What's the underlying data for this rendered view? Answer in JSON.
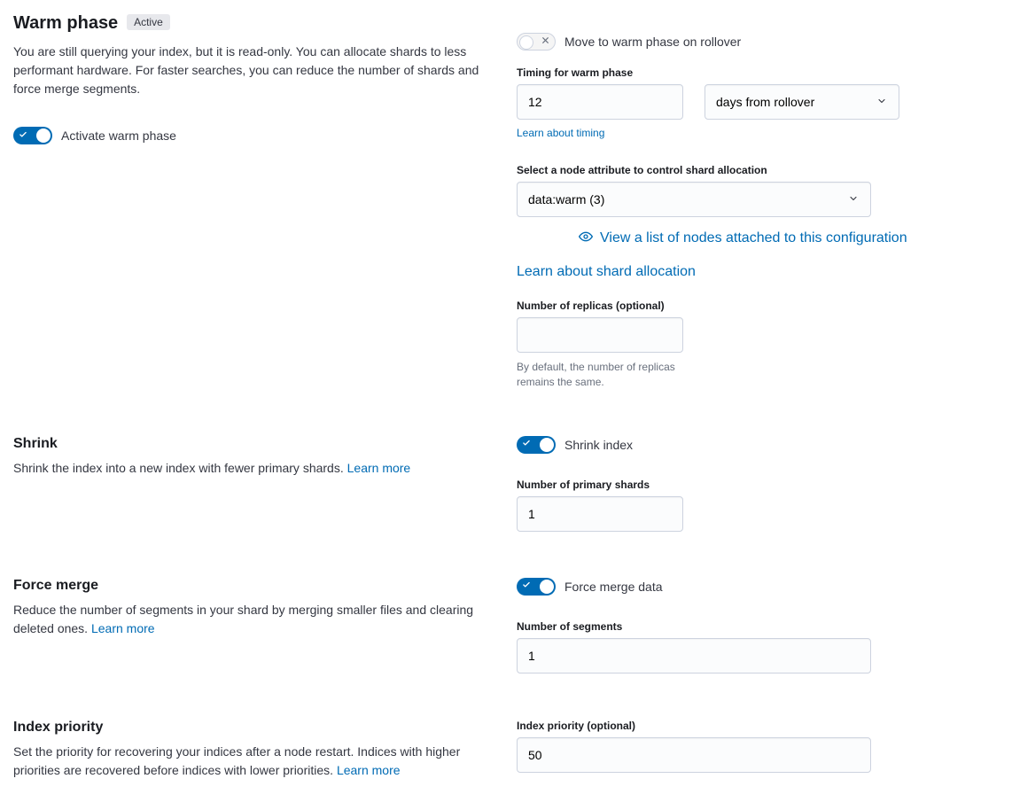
{
  "header": {
    "title": "Warm phase",
    "badge": "Active",
    "description": "You are still querying your index, but it is read-only. You can allocate shards to less performant hardware. For faster searches, you can reduce the number of shards and force merge segments.",
    "activate_label": "Activate warm phase",
    "activate_on": true
  },
  "move_rollover": {
    "label": "Move to warm phase on rollover",
    "on": false
  },
  "timing": {
    "label": "Timing for warm phase",
    "value": "12",
    "unit_selected": "days from rollover",
    "learn_link": "Learn about timing"
  },
  "node_attr": {
    "label": "Select a node attribute to control shard allocation",
    "selected": "data:warm (3)",
    "view_nodes_link": "View a list of nodes attached to this configuration",
    "learn_link": "Learn about shard allocation"
  },
  "replicas": {
    "label": "Number of replicas (optional)",
    "value": "",
    "help": "By default, the number of replicas remains the same."
  },
  "shrink": {
    "title": "Shrink",
    "desc_text": "Shrink the index into a new index with fewer primary shards. ",
    "learn_more": "Learn more",
    "toggle_label": "Shrink index",
    "toggle_on": true,
    "shards_label": "Number of primary shards",
    "shards_value": "1"
  },
  "force_merge": {
    "title": "Force merge",
    "desc_text": "Reduce the number of segments in your shard by merging smaller files and clearing deleted ones. ",
    "learn_more": "Learn more",
    "toggle_label": "Force merge data",
    "toggle_on": true,
    "segments_label": "Number of segments",
    "segments_value": "1"
  },
  "index_priority": {
    "title": "Index priority",
    "desc_text": "Set the priority for recovering your indices after a node restart. Indices with higher priorities are recovered before indices with lower priorities. ",
    "learn_more": "Learn more",
    "label": "Index priority (optional)",
    "value": "50"
  }
}
